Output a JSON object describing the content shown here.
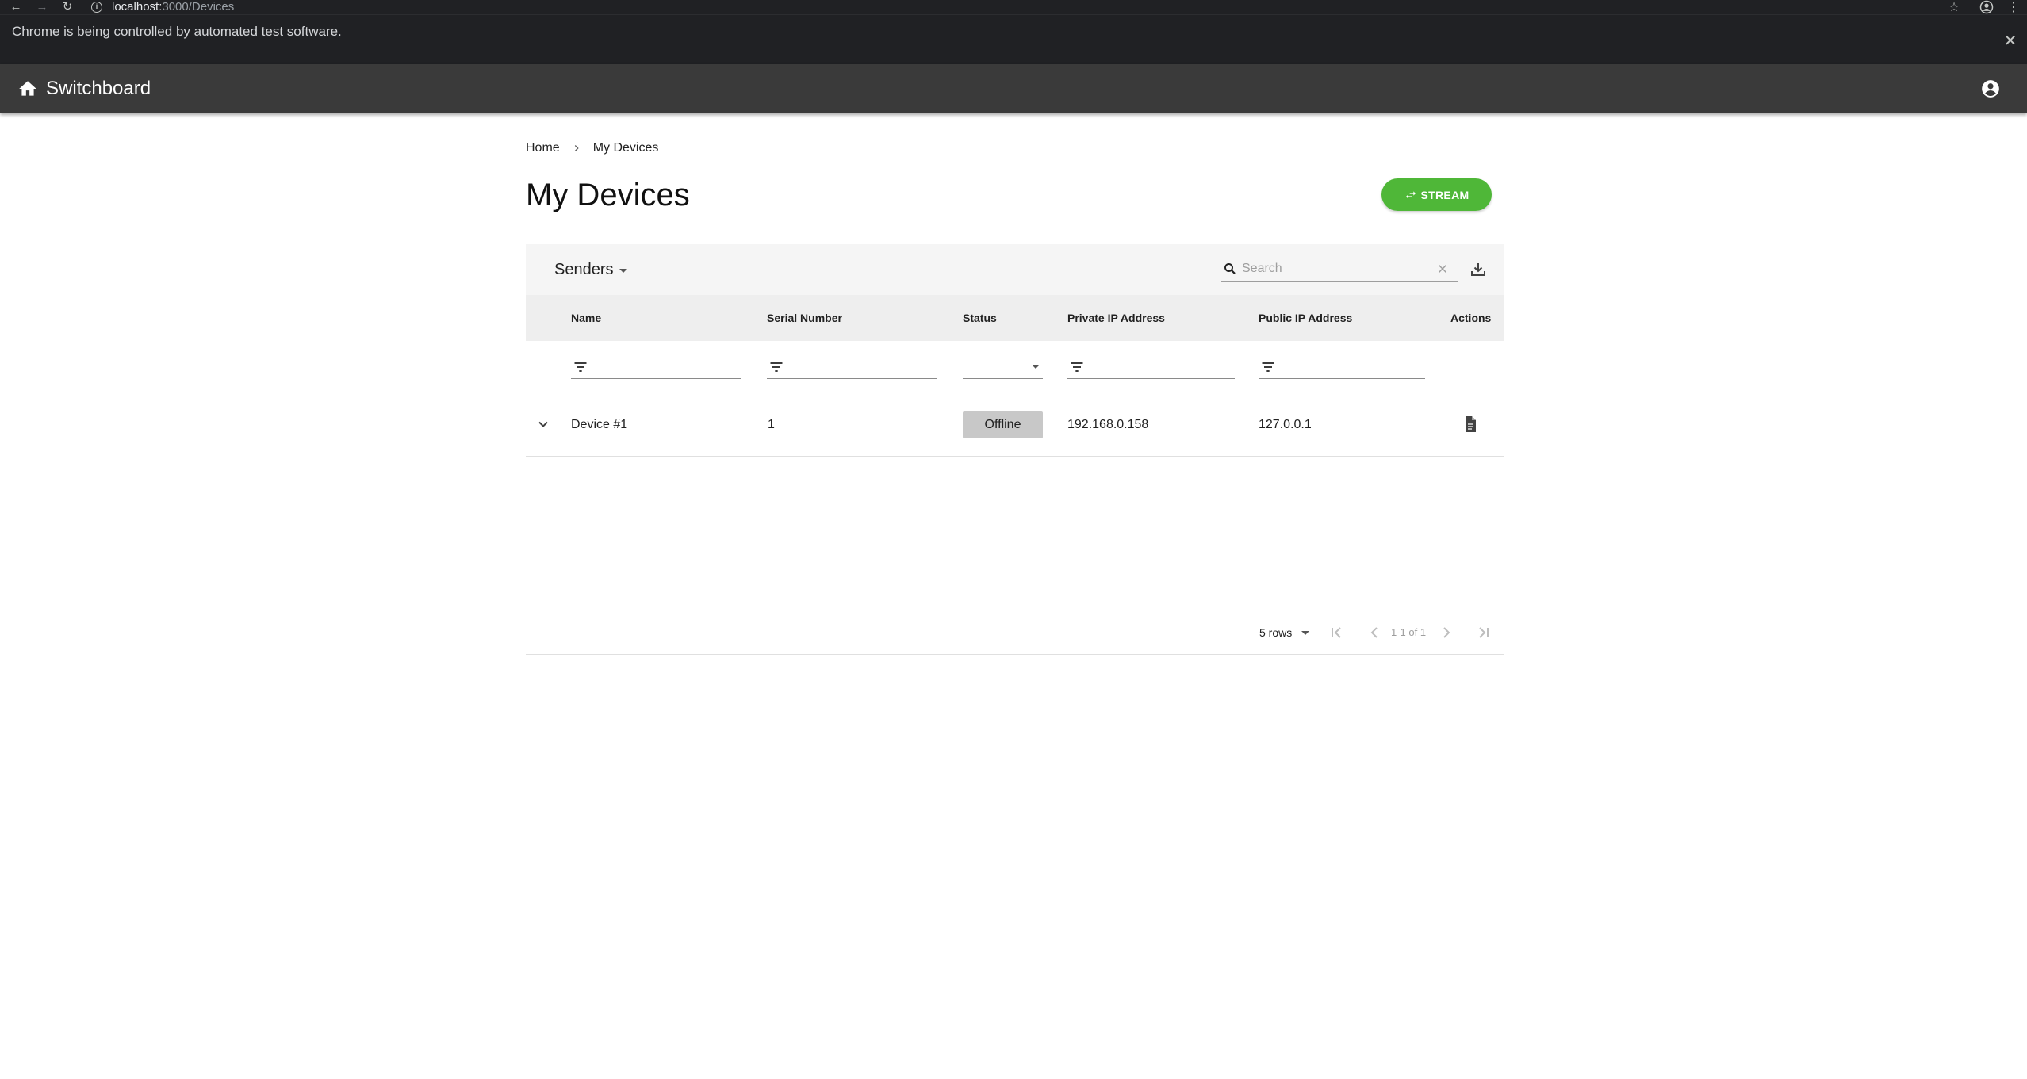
{
  "browser": {
    "url_host": "localhost:",
    "url_path": "3000/Devices",
    "infobar_message": "Chrome is being controlled by automated test software."
  },
  "appbar": {
    "title": "Switchboard",
    "icons": [
      "home-icon",
      "account-circle-icon"
    ]
  },
  "breadcrumb": {
    "home": "Home",
    "current": "My Devices"
  },
  "page": {
    "title": "My Devices",
    "stream_button": "STREAM",
    "accent_color": "#4fb738"
  },
  "table": {
    "selector_label": "Senders",
    "search_placeholder": "Search",
    "columns": [
      "Name",
      "Serial Number",
      "Status",
      "Private IP Address",
      "Public IP Address",
      "Actions"
    ],
    "rows": [
      {
        "name": "Device #1",
        "serial": "1",
        "status": "Offline",
        "private_ip": "192.168.0.158",
        "public_ip": "127.0.0.1"
      }
    ],
    "pagination": {
      "rows_per_page": "5 rows",
      "range": "1-1 of 1"
    }
  }
}
